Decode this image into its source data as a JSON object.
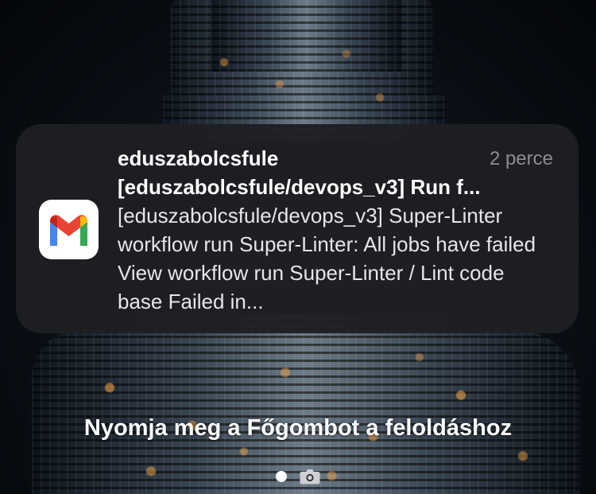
{
  "notification": {
    "app_icon": "gmail-icon",
    "sender": "eduszabolcsfule",
    "time": "2 perce",
    "subject": "[eduszabolcsfule/devops_v3] Run f...",
    "body": "[eduszabolcsfule/devops_v3] Super-Linter workflow run Super-Linter: All jobs have failed View workflow run Super-Linter / Lint code base Failed in..."
  },
  "lock_screen": {
    "unlock_hint": "Nyomja meg a Főgombot a feloldáshoz",
    "indicators": [
      "page-dot",
      "camera-icon"
    ]
  },
  "colors": {
    "card_background": "#1e1f22",
    "time_text": "#8c8c92",
    "gmail_red": "#ea4335",
    "gmail_blue": "#4285f4",
    "gmail_green": "#34a853",
    "gmail_yellow": "#fbbc04"
  }
}
